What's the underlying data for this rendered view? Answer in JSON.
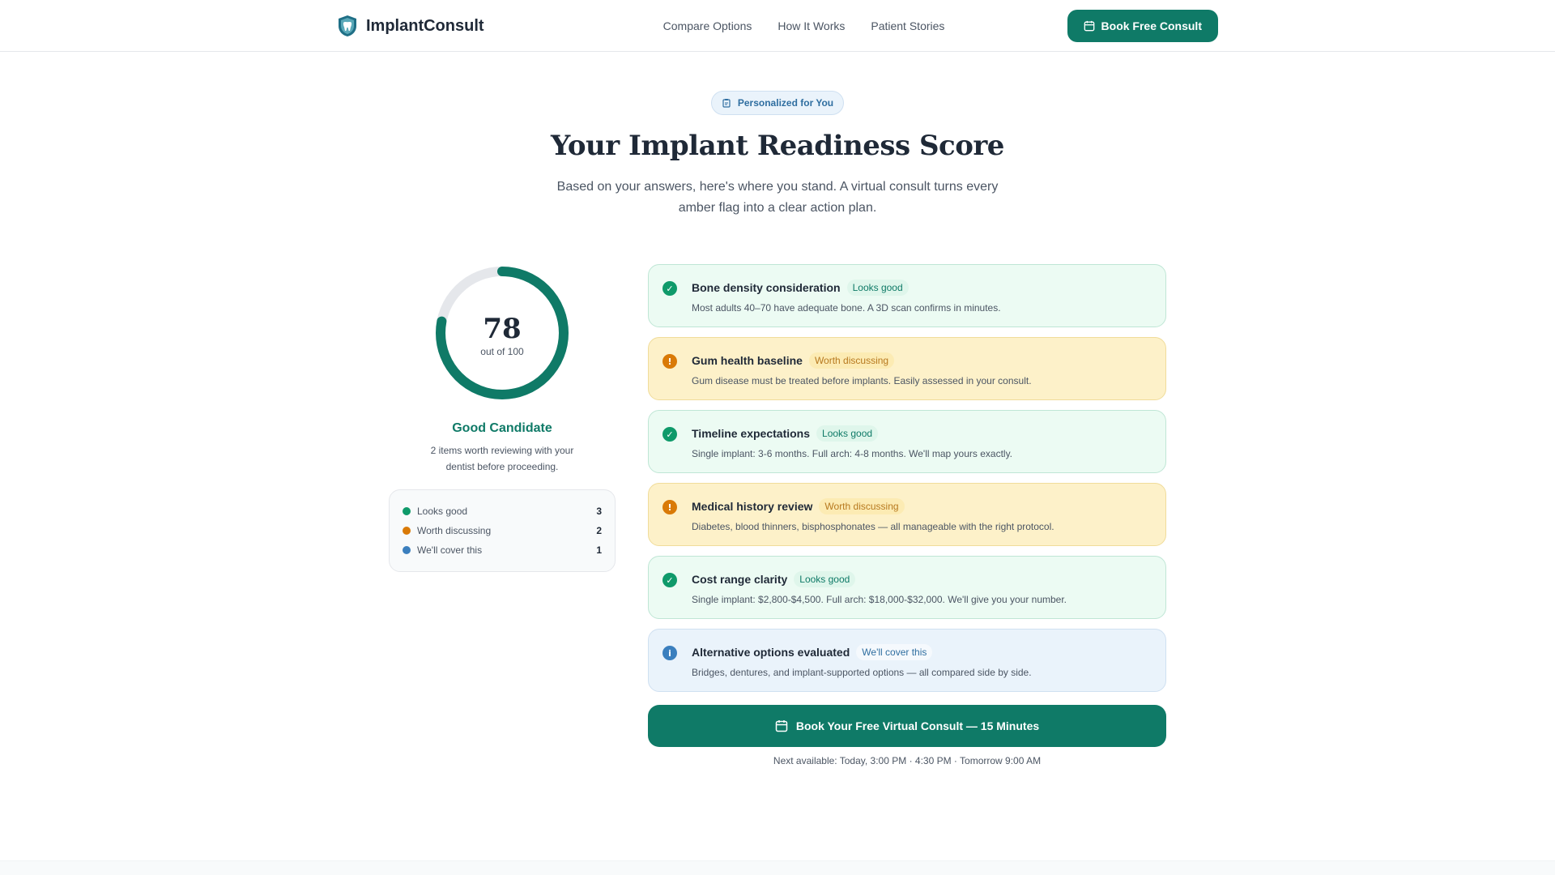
{
  "brand": {
    "name": "ImplantConsult",
    "logo_icon": "shield-tooth-icon"
  },
  "nav": {
    "links": [
      "Compare Options",
      "How It Works",
      "Patient Stories"
    ],
    "cta_label": "Book Free Consult",
    "cta_icon": "calendar-icon"
  },
  "hero": {
    "badge": "Personalized for You",
    "badge_icon": "clipboard-icon",
    "title": "Your Implant Readiness Score",
    "subtitle": "Based on your answers, here's where you stand. A virtual consult turns every amber flag into a clear action plan."
  },
  "score": {
    "value": 78,
    "max": 100,
    "out_of_label": "out of 100",
    "verdict": "Good Candidate",
    "verdict_desc": "2 items worth reviewing with your dentist before proceeding."
  },
  "legend": [
    {
      "label": "Looks good",
      "count": "3",
      "color": "#0f9a6a"
    },
    {
      "label": "Worth discussing",
      "count": "2",
      "color": "#d97a07"
    },
    {
      "label": "We'll cover this",
      "count": "1",
      "color": "#3b7fbe"
    }
  ],
  "items": [
    {
      "title": "Bone density consideration",
      "status": "Looks good",
      "desc": "Most adults 40–70 have adequate bone. A 3D scan confirms in minutes."
    },
    {
      "title": "Gum health baseline",
      "status": "Worth discussing",
      "desc": "Gum disease must be treated before implants. Easily assessed in your consult."
    },
    {
      "title": "Timeline expectations",
      "status": "Looks good",
      "desc": "Single implant: 3-6 months. Full arch: 4-8 months. We'll map yours exactly."
    },
    {
      "title": "Medical history review",
      "status": "Worth discussing",
      "desc": "Diabetes, blood thinners, bisphosphonates — all manageable with the right protocol."
    },
    {
      "title": "Cost range clarity",
      "status": "Looks good",
      "desc": "Single implant: $2,800-$4,500. Full arch: $18,000-$32,000. We'll give you your number."
    },
    {
      "title": "Alternative options evaluated",
      "status": "We'll cover this",
      "desc": "Bridges, dentures, and implant-supported options — all compared side by side."
    }
  ],
  "status_icons": {
    "good": "check-circle-icon",
    "warn": "alert-circle-icon",
    "info": "info-circle-icon"
  },
  "colors": {
    "accent": "#0f7a67",
    "good": "#0f9a6a",
    "warn": "#d97a07",
    "info": "#3b7fbe",
    "ring_track": "#e5e7eb"
  },
  "cta": {
    "label": "Book Your Free Virtual Consult — 15 Minutes",
    "availability": "Next available: Today, 3:00 PM · 4:30 PM · Tomorrow 9:00 AM"
  }
}
